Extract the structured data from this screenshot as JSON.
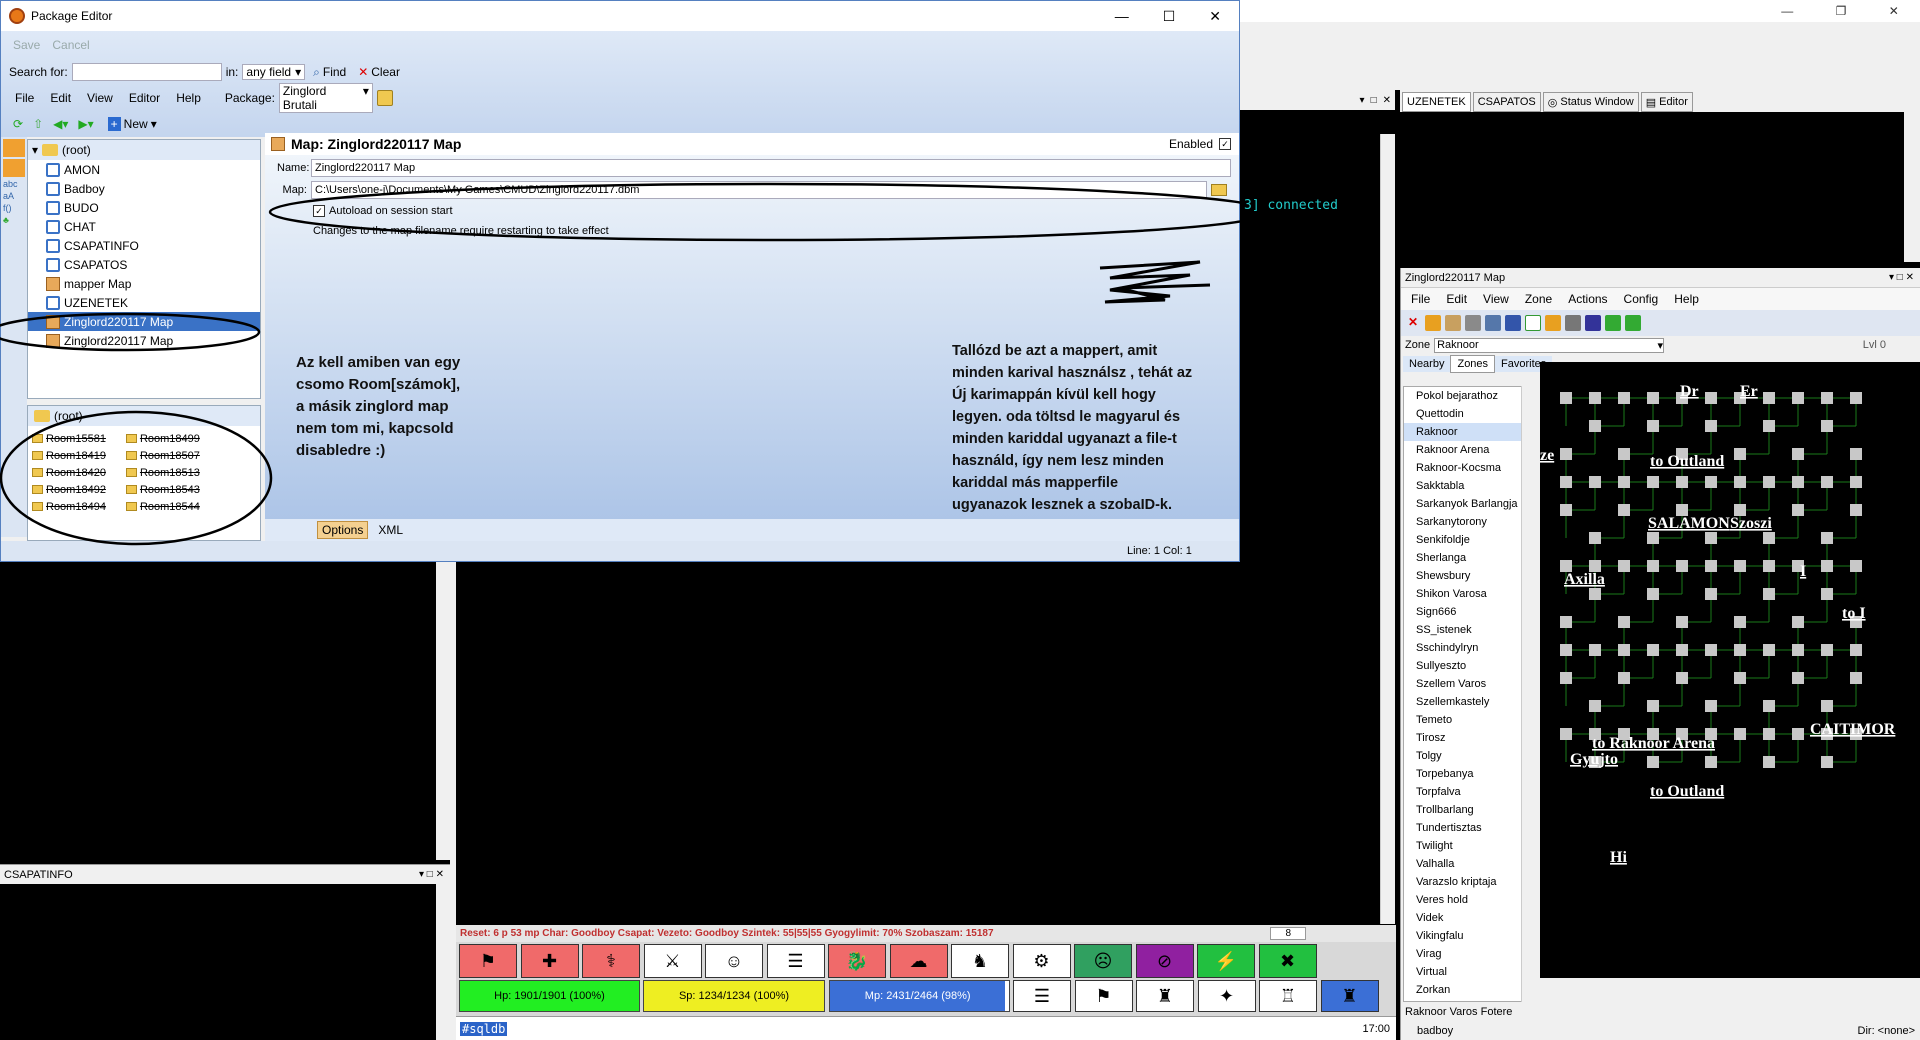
{
  "colors": {
    "accent": "#3a72c6",
    "hp": "#22ee22",
    "sp": "#eeee22",
    "mp": "#3b6fd6",
    "panel": "#c8d8f0"
  },
  "pkg": {
    "title": "Package Editor",
    "save": "Save",
    "cancel": "Cancel",
    "search_for": "Search for:",
    "in": "in:",
    "field": "any field",
    "find": "Find",
    "clear": "Clear",
    "menu": [
      "File",
      "Edit",
      "View",
      "Editor",
      "Help"
    ],
    "package_label": "Package:",
    "package_value": "Zinglord Brutali",
    "new": "New",
    "tree_root": "(root)",
    "tree": [
      "AMON",
      "Badboy",
      "BUDO",
      "CHAT",
      "CSAPATINFO",
      "CSAPATOS",
      "mapper Map",
      "UZENETEK",
      "Zinglord220117 Map",
      "Zinglord220117 Map"
    ],
    "tree2_root": "(root)",
    "rooms_left": [
      "Room15581",
      "Room18419",
      "Room18420",
      "Room18492",
      "Room18494"
    ],
    "rooms_right": [
      "Room18499",
      "Room18507",
      "Room18513",
      "Room18543",
      "Room18544"
    ],
    "map_header": "Map: Zinglord220117 Map",
    "enabled": "Enabled",
    "name_label": "Name:",
    "name_value": "Zinglord220117 Map",
    "map_label": "Map:",
    "map_value": "C:\\Users\\one-j\\Documents\\My Games\\CMUD\\Zinglord220117.dbm",
    "autoload": "Autoload on session start",
    "note": "Changes to the map filename require restarting to take effect",
    "tab_options": "Options",
    "tab_xml": "XML",
    "status": "Line: 1 Col: 1"
  },
  "annotations": {
    "left": [
      "Az kell amiben van egy",
      "csomo Room[számok],",
      "a másik zinglord map",
      "nem tom mi, kapcsold",
      "disabledre :)"
    ],
    "right": [
      "Tallózd be azt a mappert, amit",
      "minden karival használsz , tehát az",
      "Új karimappán kívül kell hogy",
      "legyen. oda töltsd le magyarul és",
      "minden kariddal ugyanazt a file-t",
      "használd, így nem lesz minden",
      "kariddal más mapperfile",
      "ugyanazok lesznek a szobaID-k."
    ]
  },
  "main": {
    "connected": "3] connected",
    "csapatinfo_title": "CSAPATINFO",
    "tabs": [
      "UZENETEK",
      "CSAPATOS",
      "Status Window",
      "Editor"
    ],
    "status_line": "Reset: 6 p 53 mp Char: Goodboy Csapat:  Vezeto: Goodboy Szintek: 55|55|55 Gyogylimit: 70% Szobaszam: 15187",
    "page_num": "8",
    "hp": "Hp: 1901/1901 (100%)",
    "sp": "Sp: 1234/1234 (100%)",
    "mp": "Mp: 2431/2464 (98%)",
    "hp_pct": 100,
    "sp_pct": 100,
    "mp_pct": 98,
    "cmd": "#sqldb",
    "time": "17:00"
  },
  "mapwin": {
    "title": "Zinglord220117 Map",
    "menu": [
      "File",
      "Edit",
      "View",
      "Zone",
      "Actions",
      "Config",
      "Help"
    ],
    "zone_label": "Zone",
    "zone_value": "Raknoor",
    "lvl": "Lvl 0",
    "tabs": [
      "Nearby",
      "Zones",
      "Favorites"
    ],
    "zones": [
      "Pokol bejarathoz",
      "Quettodin",
      "Raknoor",
      "Raknoor Arena",
      "Raknoor-Kocsma",
      "Sakktabla",
      "Sarkanyok Barlangja",
      "Sarkanytorony",
      "Senkifoldje",
      "Sherlanga",
      "Shewsbury",
      "Shikon Varosa",
      "Sign666",
      "SS_istenek",
      "Sschindylryn",
      "Sullyeszto",
      "Szellem Varos",
      "Szellemkastely",
      "Temeto",
      "Tirosz",
      "Tolgy",
      "Torpebanya",
      "Torpfalva",
      "Trollbarlang",
      "Tundertisztas",
      "Twilight",
      "Valhalla",
      "Varazslo kriptaja",
      "Veres hold",
      "Videk",
      "Vikingfalu",
      "Virag",
      "Virtual",
      "Zorkan"
    ],
    "labels": [
      "Dr",
      "Er",
      "ze",
      "to Outland",
      "SALAMON",
      "Szoszi",
      "Axilla",
      "I",
      "to I",
      "CAITIMOR",
      "to Raknoor Arena",
      "Gyujto",
      "to Outland",
      "Hi"
    ],
    "status": "Raknoor Varos Fotere",
    "char": "badboy",
    "dir": "Dir: <none>"
  },
  "right_window": {
    "maximize": "❐",
    "minimize": "—",
    "close": "✕"
  }
}
